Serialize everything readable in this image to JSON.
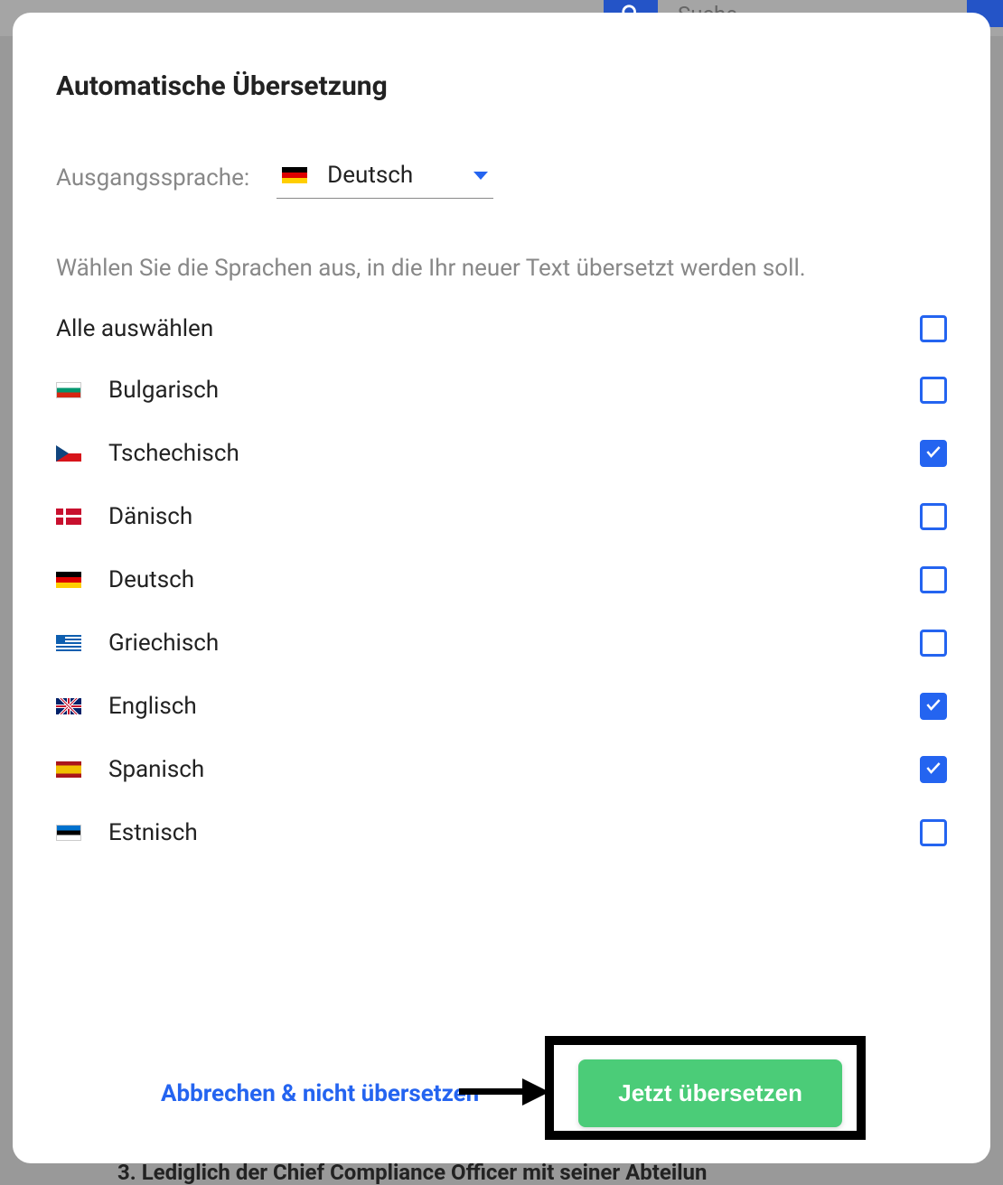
{
  "backdrop": {
    "search_placeholder": "Suche",
    "bottom_text": "3. Lediglich der Chief Compliance Officer mit seiner Abteilun"
  },
  "modal": {
    "title": "Automatische Übersetzung",
    "source_label": "Ausgangssprache:",
    "source_language": "Deutsch",
    "instruction": "Wählen Sie die Sprachen aus, in die Ihr neuer Text übersetzt werden soll.",
    "select_all_label": "Alle auswählen",
    "select_all_checked": false,
    "languages": [
      {
        "name": "Bulgarisch",
        "flag": "bg",
        "checked": false
      },
      {
        "name": "Tschechisch",
        "flag": "cz",
        "checked": true
      },
      {
        "name": "Dänisch",
        "flag": "dk",
        "checked": false
      },
      {
        "name": "Deutsch",
        "flag": "de",
        "checked": false
      },
      {
        "name": "Griechisch",
        "flag": "gr",
        "checked": false
      },
      {
        "name": "Englisch",
        "flag": "gb",
        "checked": true
      },
      {
        "name": "Spanisch",
        "flag": "es",
        "checked": true
      },
      {
        "name": "Estnisch",
        "flag": "ee",
        "checked": false
      }
    ],
    "cancel_label": "Abbrechen & nicht übersetzen",
    "translate_label": "Jetzt übersetzen"
  }
}
